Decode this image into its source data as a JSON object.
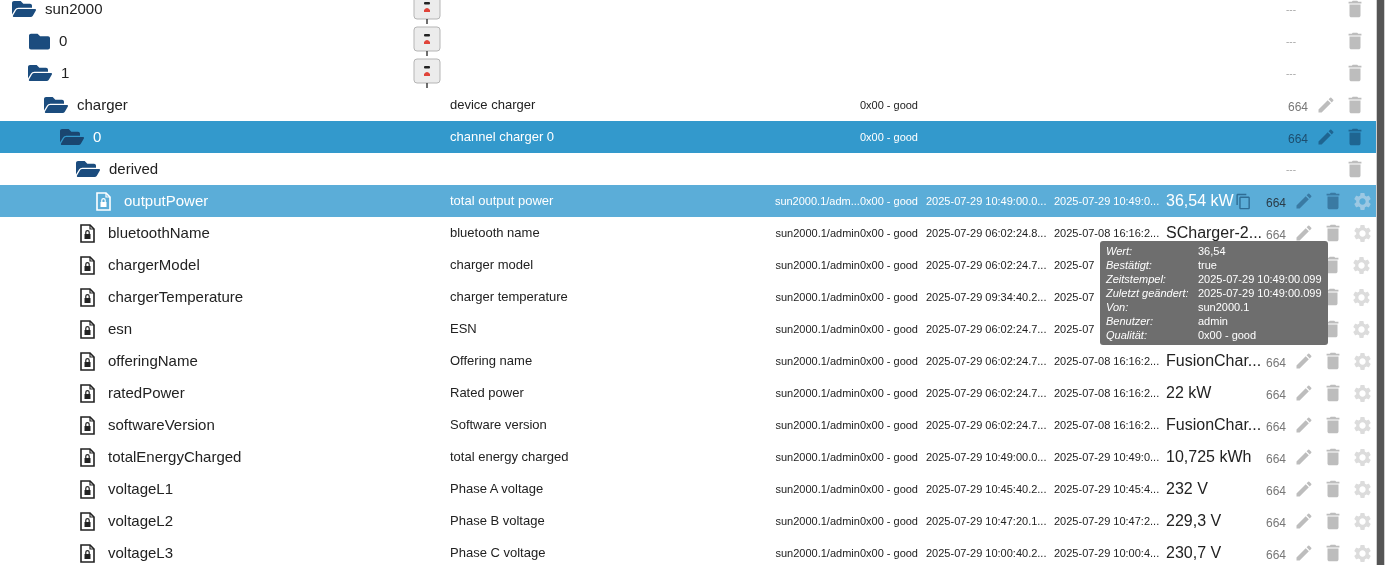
{
  "tree": [
    {
      "name": "sun2000",
      "kind": "folder",
      "expanded": true,
      "selected": false,
      "hovered": false,
      "device_icon": true,
      "acl": "---",
      "children": [
        {
          "name": "0",
          "kind": "folder",
          "expanded": false,
          "selected": false,
          "hovered": false,
          "device_icon": true,
          "acl": "---"
        },
        {
          "name": "1",
          "kind": "folder",
          "expanded": true,
          "selected": false,
          "hovered": false,
          "device_icon": true,
          "acl": "---",
          "children": [
            {
              "name": "charger",
              "kind": "folder",
              "expanded": true,
              "selected": false,
              "hovered": false,
              "common_name": "device charger",
              "quality": "0x00 - good",
              "acl": "664",
              "editable": true,
              "children": [
                {
                  "name": "0",
                  "kind": "folder",
                  "expanded": true,
                  "selected": true,
                  "hovered": false,
                  "common_name": "channel charger 0",
                  "quality": "0x00 - good",
                  "acl": "664",
                  "editable": true,
                  "children": [
                    {
                      "name": "derived",
                      "kind": "folder",
                      "expanded": true,
                      "selected": false,
                      "hovered": false,
                      "acl": "---",
                      "children": [
                        {
                          "name": "outputPower",
                          "kind": "state",
                          "selected": false,
                          "hovered": true,
                          "common_name": "total output power",
                          "from": "sun2000.1/adm...",
                          "quality": "0x00 - good",
                          "ts": "2025-07-29 10:49:00.0...",
                          "lc": "2025-07-29 10:49:0...",
                          "value": "36,54 kW",
                          "acl": "664",
                          "editable": true
                        }
                      ]
                    },
                    {
                      "name": "bluetoothName",
                      "kind": "state",
                      "selected": false,
                      "hovered": false,
                      "common_name": "bluetooth name",
                      "from": "sun2000.1/admin",
                      "quality": "0x00 - good",
                      "ts": "2025-07-29 06:02:24.8...",
                      "lc": "2025-07-08 16:16:2...",
                      "value": "SCharger-2...",
                      "acl": "664",
                      "editable": true
                    },
                    {
                      "name": "chargerModel",
                      "kind": "state",
                      "selected": false,
                      "hovered": false,
                      "common_name": "charger model",
                      "from": "sun2000.1/admin",
                      "quality": "0x00 - good",
                      "ts": "2025-07-29 06:02:24.7...",
                      "lc": "2025-07",
                      "editable": false
                    },
                    {
                      "name": "chargerTemperature",
                      "kind": "state",
                      "selected": false,
                      "hovered": false,
                      "common_name": "charger temperature",
                      "from": "sun2000.1/admin",
                      "quality": "0x00 - good",
                      "ts": "2025-07-29 09:34:40.2...",
                      "lc": "2025-07",
                      "editable": false
                    },
                    {
                      "name": "esn",
                      "kind": "state",
                      "selected": false,
                      "hovered": false,
                      "common_name": "ESN",
                      "from": "sun2000.1/admin",
                      "quality": "0x00 - good",
                      "ts": "2025-07-29 06:02:24.7...",
                      "lc": "2025-07",
                      "editable": false
                    },
                    {
                      "name": "offeringName",
                      "kind": "state",
                      "selected": false,
                      "hovered": false,
                      "common_name": "Offering name",
                      "from": "sun2000.1/admin",
                      "quality": "0x00 - good",
                      "ts": "2025-07-29 06:02:24.7...",
                      "lc": "2025-07-08 16:16:2...",
                      "value": "FusionChar...",
                      "acl": "664",
                      "editable": true
                    },
                    {
                      "name": "ratedPower",
                      "kind": "state",
                      "selected": false,
                      "hovered": false,
                      "common_name": "Rated power",
                      "from": "sun2000.1/admin",
                      "quality": "0x00 - good",
                      "ts": "2025-07-29 06:02:24.7...",
                      "lc": "2025-07-08 16:16:2...",
                      "value": "22 kW",
                      "acl": "664",
                      "editable": true
                    },
                    {
                      "name": "softwareVersion",
                      "kind": "state",
                      "selected": false,
                      "hovered": false,
                      "common_name": "Software version",
                      "from": "sun2000.1/admin",
                      "quality": "0x00 - good",
                      "ts": "2025-07-29 06:02:24.7...",
                      "lc": "2025-07-08 16:16:2...",
                      "value": "FusionChar...",
                      "acl": "664",
                      "editable": true
                    },
                    {
                      "name": "totalEnergyCharged",
                      "kind": "state",
                      "selected": false,
                      "hovered": false,
                      "common_name": "total energy charged",
                      "from": "sun2000.1/admin",
                      "quality": "0x00 - good",
                      "ts": "2025-07-29 10:49:00.0...",
                      "lc": "2025-07-29 10:49:0...",
                      "value": "10,725 kWh",
                      "acl": "664",
                      "editable": true
                    },
                    {
                      "name": "voltageL1",
                      "kind": "state",
                      "selected": false,
                      "hovered": false,
                      "common_name": "Phase A voltage",
                      "from": "sun2000.1/admin",
                      "quality": "0x00 - good",
                      "ts": "2025-07-29 10:45:40.2...",
                      "lc": "2025-07-29 10:45:4...",
                      "value": "232 V",
                      "acl": "664",
                      "editable": true
                    },
                    {
                      "name": "voltageL2",
                      "kind": "state",
                      "selected": false,
                      "hovered": false,
                      "common_name": "Phase B voltage",
                      "from": "sun2000.1/admin",
                      "quality": "0x00 - good",
                      "ts": "2025-07-29 10:47:20.1...",
                      "lc": "2025-07-29 10:47:2...",
                      "value": "229,3 V",
                      "acl": "664",
                      "editable": true
                    },
                    {
                      "name": "voltageL3",
                      "kind": "state",
                      "selected": false,
                      "hovered": false,
                      "common_name": "Phase C voltage",
                      "from": "sun2000.1/admin",
                      "quality": "0x00 - good",
                      "ts": "2025-07-29 10:00:40.2...",
                      "lc": "2025-07-29 10:00:4...",
                      "value": "230,7 V",
                      "acl": "664",
                      "editable": true
                    }
                  ]
                }
              ]
            }
          ]
        }
      ]
    }
  ],
  "tooltip": [
    {
      "label": "Wert:",
      "value": "36,54"
    },
    {
      "label": "Bestätigt:",
      "value": "true"
    },
    {
      "label": "Zeitstempel:",
      "value": "2025-07-29 10:49:00.099"
    },
    {
      "label": "Zuletzt geändert:",
      "value": "2025-07-29 10:49:00.099"
    },
    {
      "label": "Von:",
      "value": "sun2000.1"
    },
    {
      "label": "Benutzer:",
      "value": "admin"
    },
    {
      "label": "Qualität:",
      "value": "0x00 - good"
    }
  ]
}
